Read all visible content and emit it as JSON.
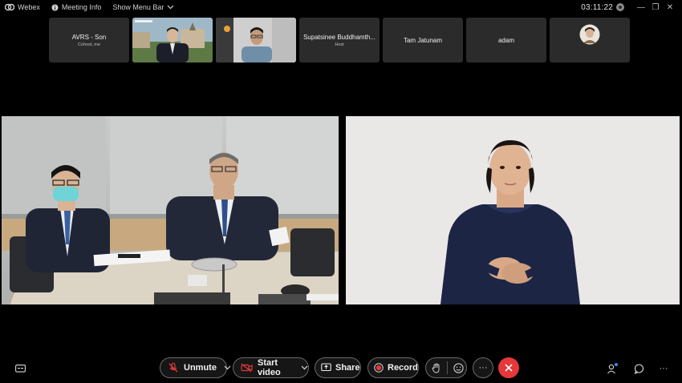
{
  "titlebar": {
    "app_name": "Webex",
    "meeting_info": "Meeting Info",
    "show_menu_bar": "Show Menu Bar",
    "clock": "03:11:22"
  },
  "participants": [
    {
      "name": "AVRS - Son",
      "role": "Cohost, me",
      "type": "name"
    },
    {
      "name": "",
      "role": "",
      "type": "video-man-suit"
    },
    {
      "name": "",
      "role": "",
      "type": "video-man-glasses"
    },
    {
      "name": "Supatsinee Buddhamth...",
      "role": "Host",
      "type": "name"
    },
    {
      "name": "Tam Jatunam",
      "role": "",
      "type": "name"
    },
    {
      "name": "adam",
      "role": "",
      "type": "name"
    },
    {
      "name": "",
      "role": "",
      "type": "avatar"
    }
  ],
  "toolbar": {
    "unmute_label": "Unmute",
    "start_video_label": "Start video",
    "share_label": "Share",
    "record_label": "Record",
    "more_label": "···",
    "overflow_label": "···"
  },
  "colors": {
    "background": "#000000",
    "tile": "#2b2b2b",
    "end_call": "#e5383b",
    "record_red": "#e5383b",
    "mute_red": "#e5383b",
    "badge_blue": "#3b8fe5"
  },
  "icons": [
    "webex-logo-icon",
    "info-icon",
    "chevron-down-icon",
    "minimize-icon",
    "restore-icon",
    "close-icon",
    "captions-icon",
    "mic-muted-icon",
    "video-off-icon",
    "share-icon",
    "record-icon",
    "raise-hand-icon",
    "reactions-icon",
    "more-icon",
    "end-call-icon",
    "participants-icon",
    "chat-icon"
  ]
}
